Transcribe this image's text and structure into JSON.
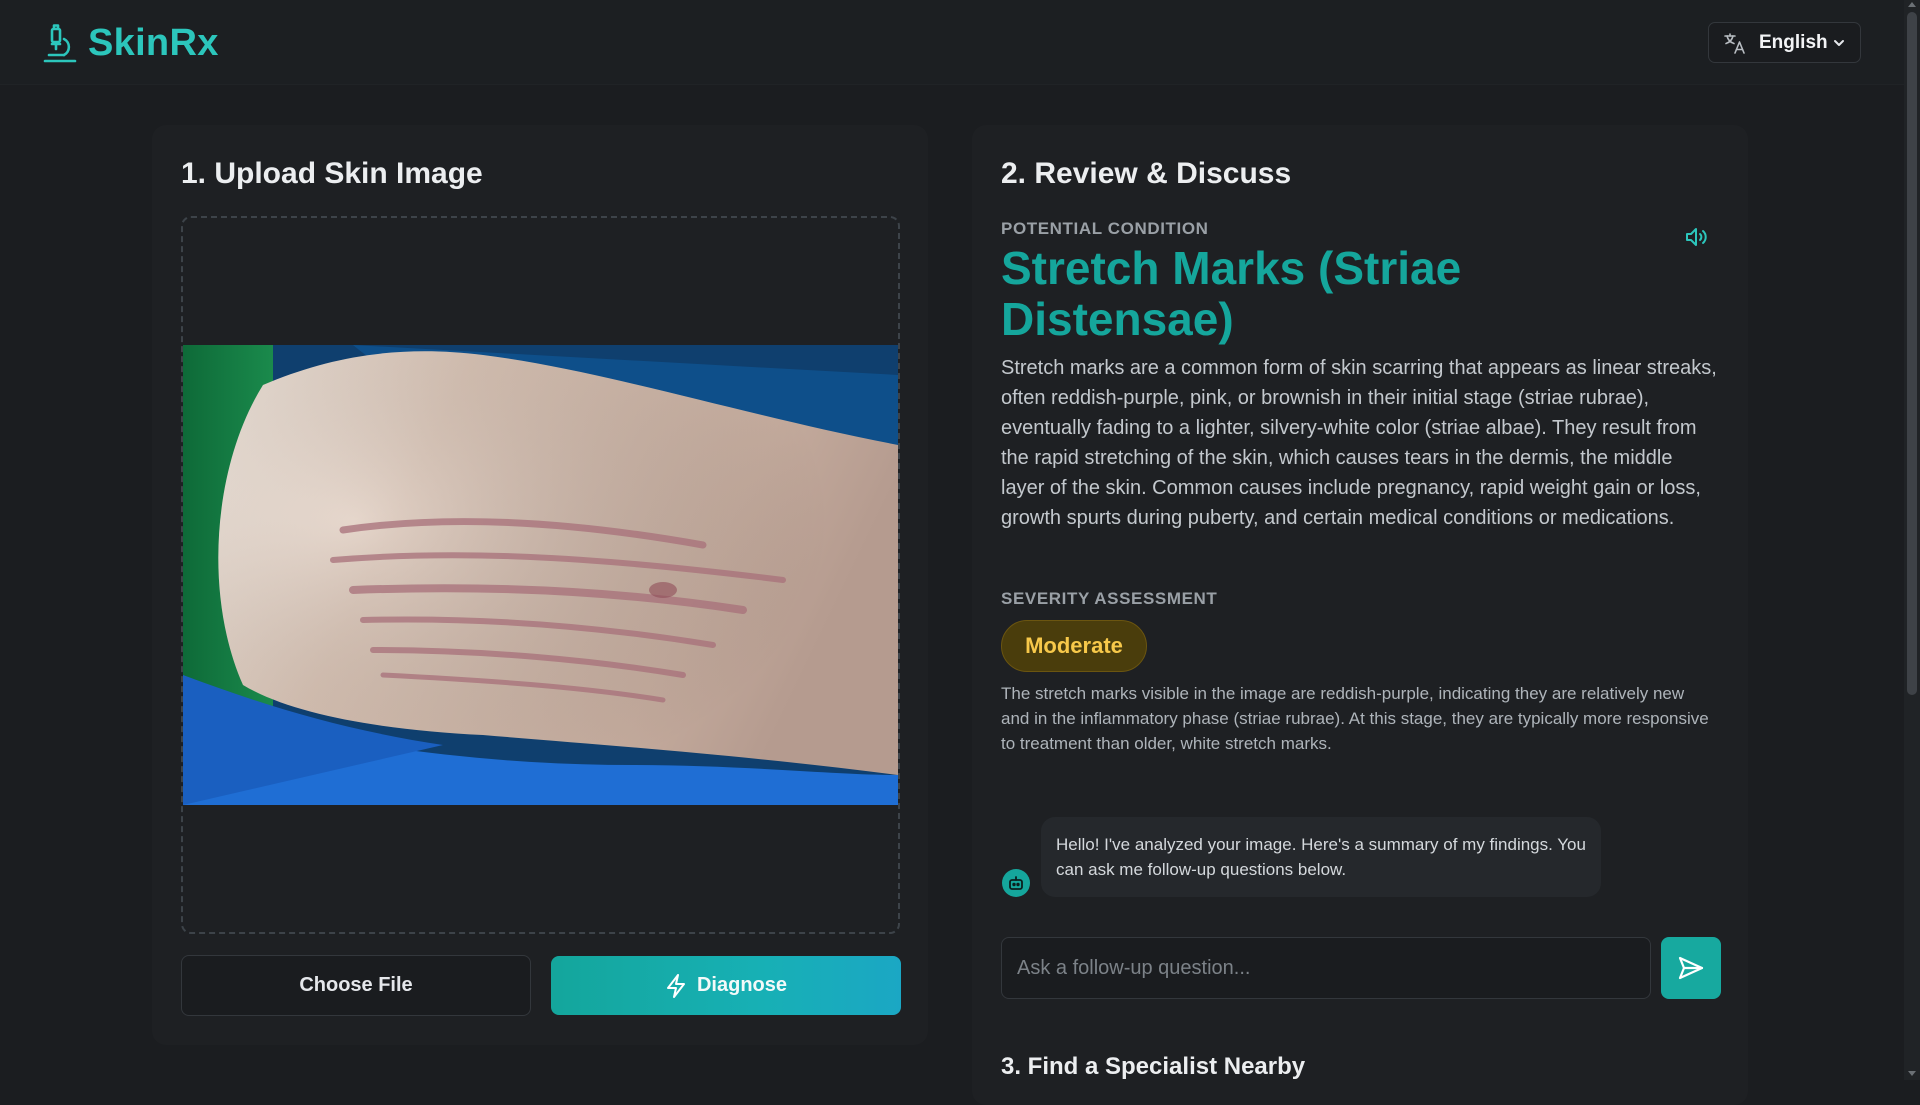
{
  "header": {
    "brand": "SkinRx",
    "brand_color": "#2cc6bc",
    "logo_icon": "microscope-icon",
    "language": {
      "icon": "translate-icon",
      "selected": "English"
    }
  },
  "upload": {
    "title": "1. Upload Skin Image",
    "choose_file_label": "Choose File",
    "diagnose_label": "Diagnose",
    "diagnose_icon": "lightning-icon"
  },
  "review": {
    "title": "2. Review & Discuss",
    "condition_label": "POTENTIAL CONDITION",
    "condition_name": "Stretch Marks (Striae Distensae)",
    "description": "Stretch marks are a common form of skin scarring that appears as linear streaks, often reddish-purple, pink, or brownish in their initial stage (striae rubrae), eventually fading to a lighter, silvery-white color (striae albae). They result from the rapid stretching of the skin, which causes tears in the dermis, the middle layer of the skin. Common causes include pregnancy, rapid weight gain or loss, growth spurts during puberty, and certain medical conditions or medications.",
    "severity_label": "SEVERITY ASSESSMENT",
    "severity": "Moderate",
    "severity_note": "The stretch marks visible in the image are reddish-purple, indicating they are relatively new and in the inflammatory phase (striae rubrae). At this stage, they are typically more responsive to treatment than older, white stretch marks.",
    "speaker_icon": "speaker-icon",
    "accent_color": "#15a69c",
    "severity_color": "#f7c84a"
  },
  "chat": {
    "bot_message": "Hello! I've analyzed your image. Here's a summary of my findings. You can ask me follow-up questions below.",
    "input_placeholder": "Ask a follow-up question...",
    "send_icon": "send-icon"
  },
  "specialist": {
    "title": "3. Find a Specialist Nearby"
  }
}
